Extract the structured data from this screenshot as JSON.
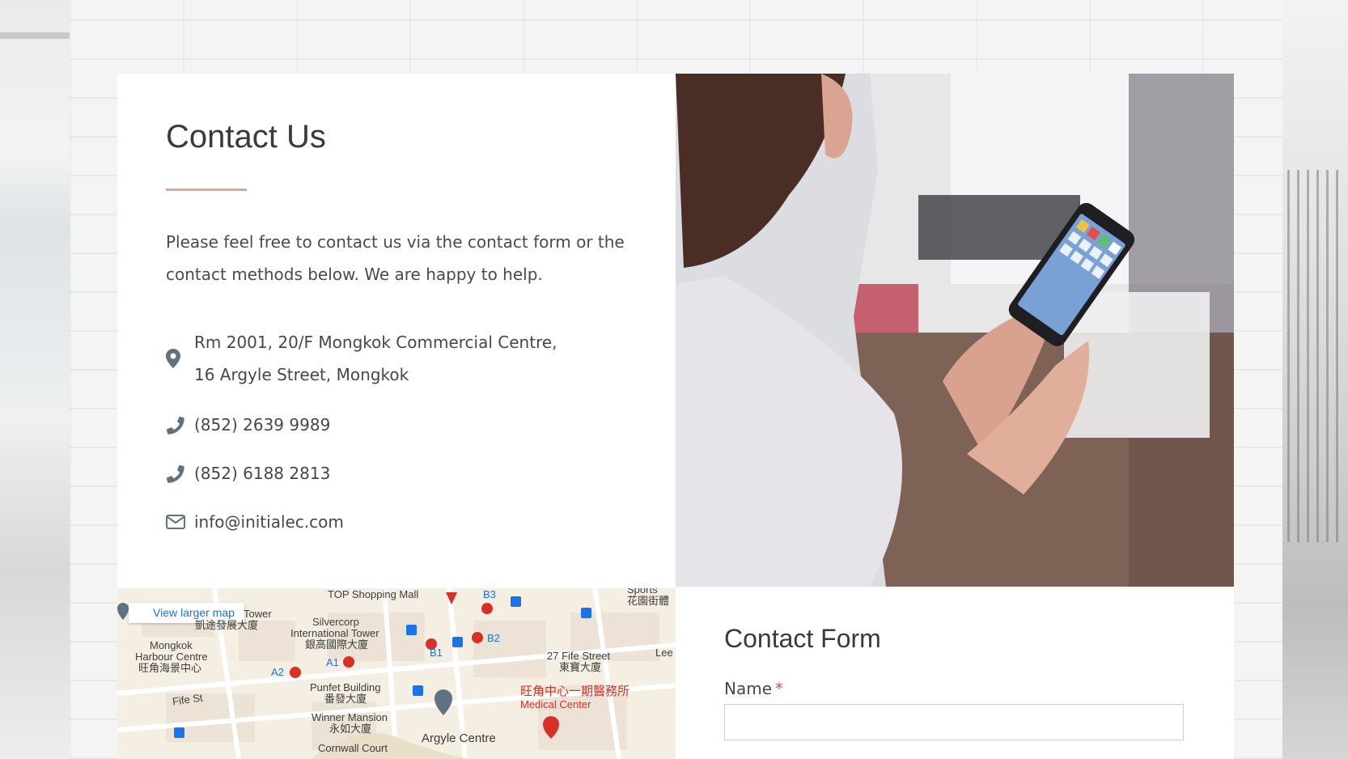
{
  "contact": {
    "title": "Contact Us",
    "intro": "Please feel free to contact us via the contact form or the contact methods below. We are happy to help.",
    "address_line1": "Rm 2001, 20/F Mongkok Commercial Centre,",
    "address_line2": "16 Argyle Street, Mongkok",
    "phone1": "(852) 2639 9989",
    "phone2": "(852) 6188 2813",
    "email": "info@initialec.com"
  },
  "map": {
    "view_larger": "View larger map",
    "labels": {
      "top_mall": "TOP Shopping Mall",
      "b3": "B3",
      "tower": "Tower",
      "silvercorp_cn": "凱途發展大廈",
      "silvercorp_en1": "Silvercorp",
      "silvercorp_en2": "International Tower",
      "silvercorp_cn2": "銀高國際大廈",
      "mongkok_harbour1": "Mongkok",
      "mongkok_harbour2": "Harbour Centre",
      "mongkok_harbour_cn": "旺角海景中心",
      "a1": "A1",
      "a2": "A2",
      "b1": "B1",
      "b2": "B2",
      "fife_st": "Fife St",
      "punfet1": "Punfet Building",
      "punfet_cn": "番發大廈",
      "winner1": "Winner Mansion",
      "winner_cn": "永如大廈",
      "cornwall": "Cornwall Court",
      "argyle_centre": "Argyle Centre",
      "fife_street27_en": "27 Fife Street",
      "fife_street27_cn": "東寶大廈",
      "medical_cn": "旺角中心一期醫務所",
      "medical_en": "Medical Center",
      "lee": "Lee",
      "sports_en": "Sports",
      "sports_cn": "花園街體"
    }
  },
  "form": {
    "title": "Contact Form",
    "name_label": "Name",
    "required_mark": "*",
    "name_value": ""
  },
  "colors": {
    "accent_rule": "#d7a99a",
    "icon": "#5f7281",
    "map_link": "#1a73e8",
    "required": "#d9534f"
  },
  "icons": [
    "map-pin-icon",
    "phone-icon",
    "envelope-icon",
    "map-marker-icon"
  ]
}
